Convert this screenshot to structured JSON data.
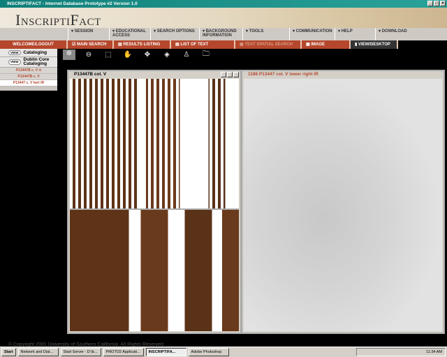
{
  "window": {
    "title": "INSCRIPTIFACT  -  Internet Database Prototype #2 Version 1.0",
    "controls": [
      "_",
      "□",
      "×"
    ]
  },
  "logo": "InscriptiFact",
  "menu": [
    {
      "label": "SESSION"
    },
    {
      "label": "EDUCATIONAL\nACCESS"
    },
    {
      "label": "SEARCH OPTIONS"
    },
    {
      "label": "BACKGROUND\nINFORMATION"
    },
    {
      "label": "TOOLS"
    },
    {
      "label": "COMMUNICATION"
    },
    {
      "label": "HELP"
    },
    {
      "label": "DOWNLOAD"
    }
  ],
  "tabs": [
    {
      "label": "WELCOME/LOGOUT"
    },
    {
      "label": "MAIN SEARCH"
    },
    {
      "label": "RESULTS LISTING"
    },
    {
      "label": "LIST OF TEXT DIVISIONS"
    },
    {
      "label": "TEXT SPATIAL SEARCH"
    },
    {
      "label": "IMAGE RESULTS"
    },
    {
      "label": "VIEW/DESKTOP"
    }
  ],
  "sidebar": {
    "view_label": "VIEW",
    "sections": [
      {
        "label": "Cataloging"
      },
      {
        "label": "Dublin Core Cataloging"
      }
    ],
    "items": [
      {
        "label": "P13447B c. V rt"
      },
      {
        "label": "P13447B c. V"
      },
      {
        "label": "P13447 c. V lwrt IR"
      }
    ]
  },
  "toolbar": {
    "icons": [
      "zoom-in-icon",
      "zoom-out-icon",
      "select-rect-icon",
      "hand-pan-icon",
      "move-icon",
      "tag-icon",
      "person-icon",
      "folder-icon"
    ]
  },
  "windows": [
    {
      "title": "P13447B col. V"
    },
    {
      "title": "1188 P13447 col. V lower right IR"
    }
  ],
  "footer": {
    "copyright": "© Copyright 2001 University of Southern California. All Rights Reserved."
  },
  "taskbar": {
    "start": "Start",
    "items": [
      {
        "label": "Network and Dial..."
      },
      {
        "label": "Start Server - D:\\b..."
      },
      {
        "label": "PROTO2 Applicati..."
      },
      {
        "label": "INSCRIPTIFA..."
      },
      {
        "label": "Adobe Photoshop"
      }
    ],
    "clock": "11:34 AM"
  }
}
